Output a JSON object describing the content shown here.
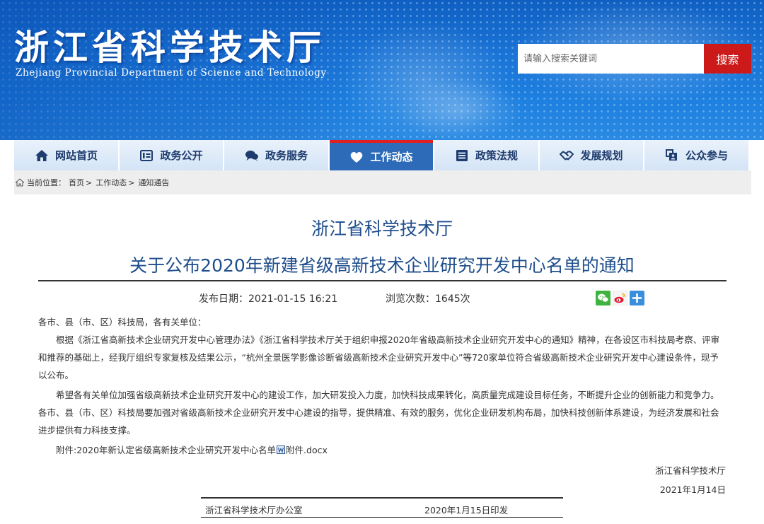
{
  "header": {
    "site_title": "浙江省科学技术厅",
    "site_subtitle": "Zhejiang Provincial Department of Science and Technology",
    "search_placeholder": "请输入搜索关键词",
    "search_button": "搜索"
  },
  "nav": {
    "items": [
      {
        "label": "网站首页",
        "icon": "home-icon"
      },
      {
        "label": "政务公开",
        "icon": "document-list-icon"
      },
      {
        "label": "政务服务",
        "icon": "chat-bubbles-icon"
      },
      {
        "label": "工作动态",
        "icon": "heart-icon",
        "active": true
      },
      {
        "label": "政策法规",
        "icon": "list-icon"
      },
      {
        "label": "发展规划",
        "icon": "handshake-icon"
      },
      {
        "label": "公众参与",
        "icon": "people-icon"
      }
    ]
  },
  "breadcrumb": {
    "prefix": "当前位置：",
    "items": [
      "首页",
      "工作动态",
      "通知通告"
    ],
    "separator": ">"
  },
  "article": {
    "title_line1": "浙江省科学技术厅",
    "title_line2": "关于公布2020年新建省级高新技术企业研究开发中心名单的通知",
    "publish_date": "发布日期：2021-01-15 16:21",
    "view_count": "浏览次数：1645次",
    "greeting": "各市、县（市、区）科技局，各有关单位：",
    "paragraph1": "根据《浙江省高新技术企业研究开发中心管理办法》《浙江省科学技术厅关于组织申报2020年省级高新技术企业研究开发中心的通知》精神，在各设区市科技局考察、评审和推荐的基础上，经我厅组织专家复核及结果公示，“杭州全景医学影像诊断省级高新技术企业研究开发中心”等720家单位符合省级高新技术企业研究开发中心建设条件，现予以公布。",
    "paragraph2": "希望各有关单位加强省级高新技术企业研究开发中心的建设工作，加大研发投入力度，加快科技成果转化，高质量完成建设目标任务，不断提升企业的创新能力和竞争力。各市、县（市、区）科技局要加强对省级高新技术企业研究开发中心建设的指导，提供精准、有效的服务，优化企业研发机构布局，加快科技创新体系建设，为经济发展和社会进步提供有力科技支撑。",
    "attachment_prefix": "附件:2020年新认定省级高新技术企业研究开发中心名单",
    "attachment_file": "附件.docx",
    "signature_org": "浙江省科学技术厅",
    "signature_date": "2021年1月14日"
  },
  "footer": {
    "office": "浙江省科学技术厅办公室",
    "print_date": "2020年1月15日印发"
  },
  "colors": {
    "header_blue": "#1a74d6",
    "search_red": "#cc1a1a",
    "nav_active": "#2d6bb8",
    "title_blue": "#1f4e8c"
  }
}
